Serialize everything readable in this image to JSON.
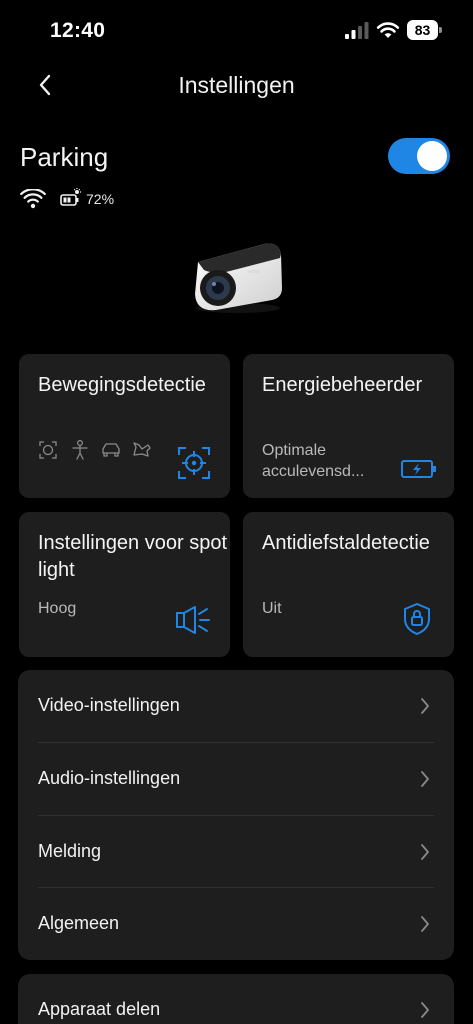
{
  "status_bar": {
    "time": "12:40",
    "battery_level": "83"
  },
  "header": {
    "title": "Instellingen"
  },
  "device": {
    "name": "Parking",
    "power_on": true,
    "battery_percent": "72%"
  },
  "cards": [
    {
      "title": "Bewegingsdetectie",
      "subtitle": "",
      "icon": "motion-target-icon"
    },
    {
      "title": "Energiebeheerder",
      "subtitle": "Optimale acculevensd...",
      "icon": "battery-charging-icon"
    },
    {
      "title": "Instellingen voor spotlight",
      "subtitle": "Hoog",
      "icon": "spotlight-icon"
    },
    {
      "title": "Antidiefstaldetectie",
      "subtitle": "Uit",
      "icon": "shield-lock-icon"
    }
  ],
  "motion_types": [
    "face-icon",
    "person-icon",
    "car-icon",
    "pet-icon"
  ],
  "settings_list": [
    {
      "label": "Video-instellingen"
    },
    {
      "label": "Audio-instellingen"
    },
    {
      "label": "Melding"
    },
    {
      "label": "Algemeen"
    }
  ],
  "share_list": [
    {
      "label": "Apparaat delen"
    }
  ],
  "colors": {
    "accent": "#1f86e6",
    "card_background": "#1e1e1e",
    "background": "#000000"
  }
}
